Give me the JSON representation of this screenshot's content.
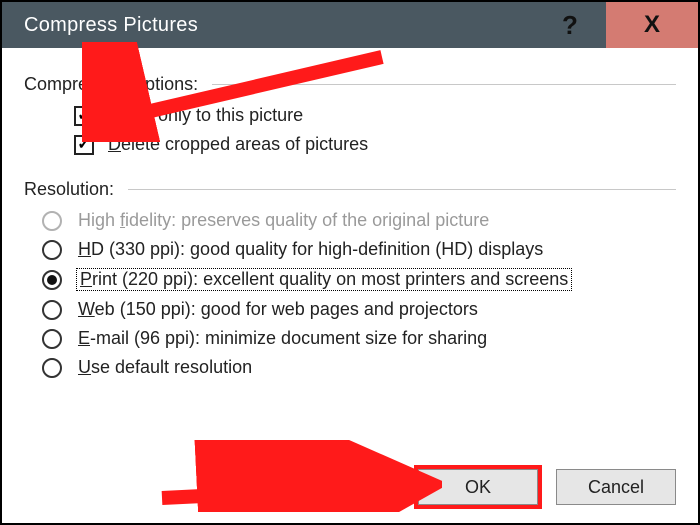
{
  "title": "Compress Pictures",
  "help_btn": "?",
  "close_btn": "X",
  "compression": {
    "section_label": "Compression options:",
    "apply_only": {
      "checked": true,
      "label_pre": "A",
      "label_post": "pply only to this picture"
    },
    "delete_cropped": {
      "checked": true,
      "label_pre": "D",
      "label_post": "elete cropped areas of pictures"
    }
  },
  "resolution": {
    "section_label": "Resolution:",
    "options": {
      "high_fidelity": {
        "enabled": false,
        "selected": false,
        "pre": "High ",
        "u": "f",
        "post": "idelity: preserves quality of the original picture"
      },
      "hd": {
        "enabled": true,
        "selected": false,
        "pre": "",
        "u": "H",
        "post": "D (330 ppi): good quality for high-definition (HD) displays"
      },
      "print": {
        "enabled": true,
        "selected": true,
        "pre": "",
        "u": "P",
        "post": "rint (220 ppi): excellent quality on most printers and screens"
      },
      "web": {
        "enabled": true,
        "selected": false,
        "pre": "",
        "u": "W",
        "post": "eb (150 ppi): good for web pages and projectors"
      },
      "email": {
        "enabled": true,
        "selected": false,
        "pre": "",
        "u": "E",
        "post": "-mail (96 ppi): minimize document size for sharing"
      },
      "default": {
        "enabled": true,
        "selected": false,
        "pre": "",
        "u": "U",
        "post": "se default resolution"
      }
    }
  },
  "buttons": {
    "ok": "OK",
    "cancel": "Cancel"
  }
}
